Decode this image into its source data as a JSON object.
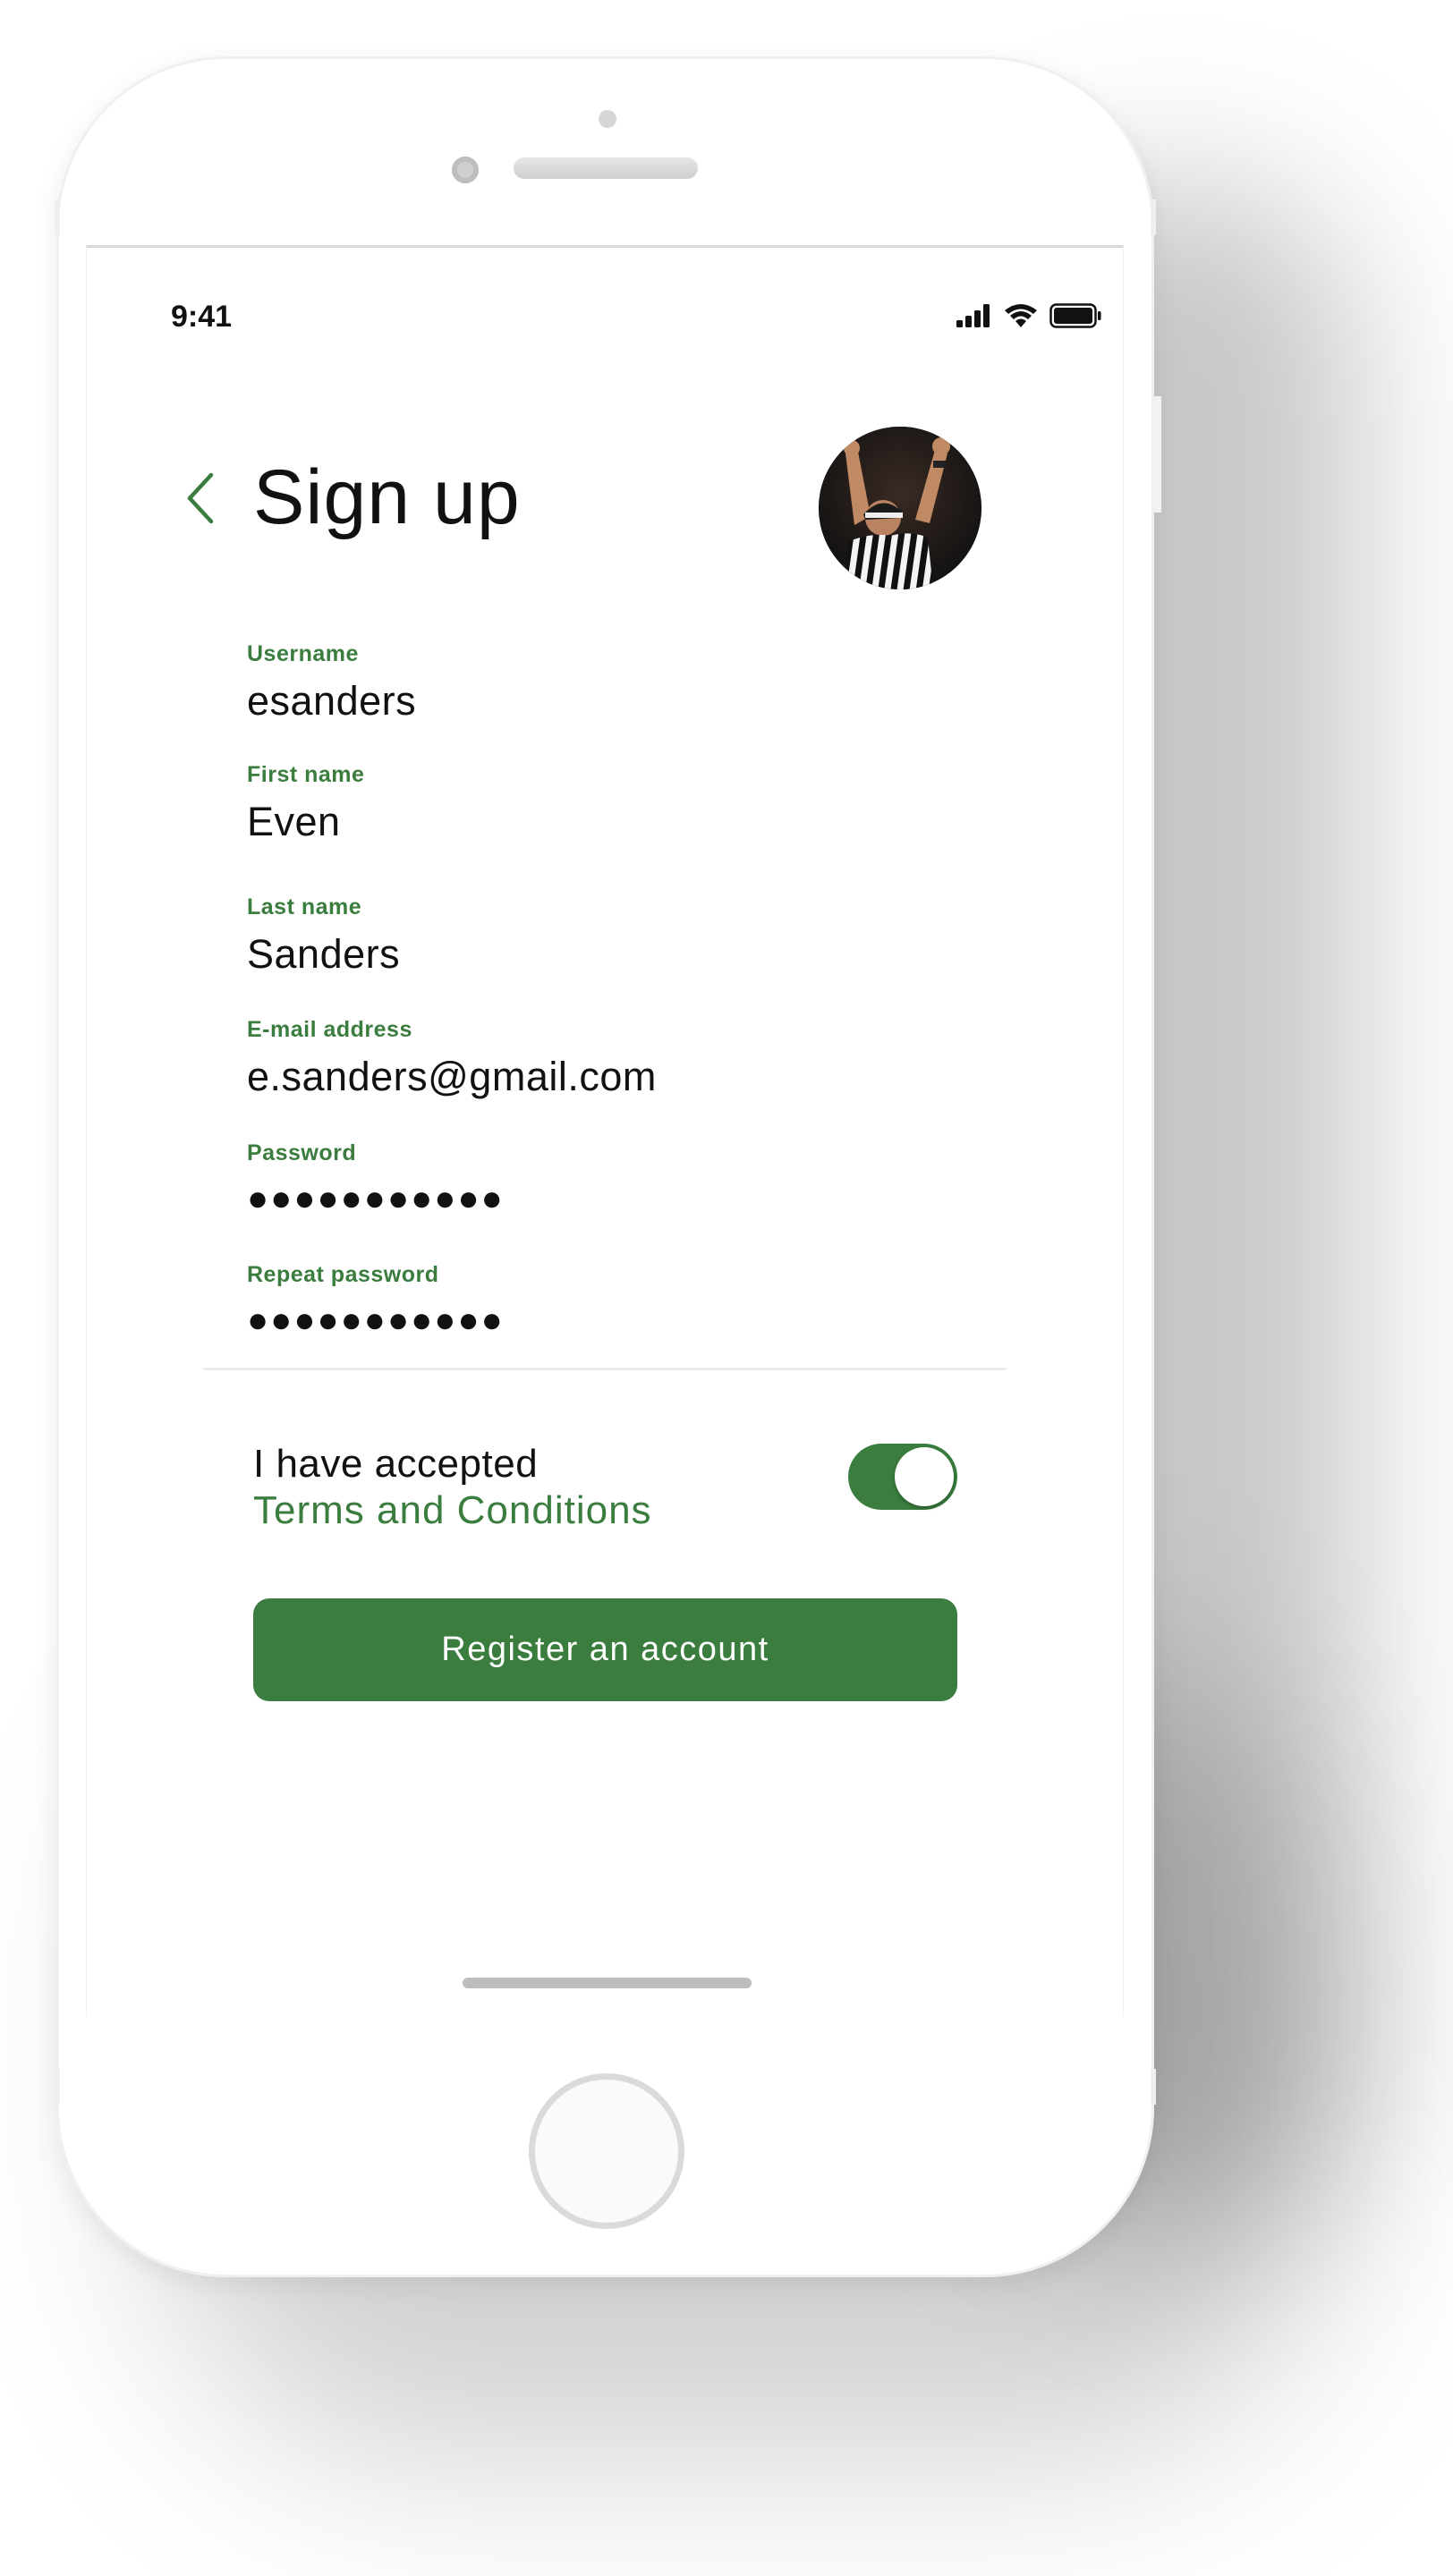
{
  "status_bar": {
    "time": "9:41",
    "icons": [
      "cellular-signal-icon",
      "wifi-icon",
      "battery-icon"
    ]
  },
  "header": {
    "back_icon": "chevron-left-icon",
    "title": "Sign up",
    "avatar": "referee-avatar"
  },
  "form": {
    "fields": [
      {
        "label": "Username",
        "value": "esanders"
      },
      {
        "label": "First name",
        "value": "Even"
      },
      {
        "label": "Last name",
        "value": "Sanders"
      },
      {
        "label": "E-mail address",
        "value": "e.sanders@gmail.com"
      },
      {
        "label": "Password",
        "value": "●●●●●●●●●●●"
      },
      {
        "label": "Repeat password",
        "value": "●●●●●●●●●●●"
      }
    ]
  },
  "terms": {
    "text": "I have accepted",
    "link": "Terms and Conditions",
    "accepted": true
  },
  "register": {
    "label": "Register an account"
  },
  "colors": {
    "accent": "#3a7d3e",
    "text": "#111111",
    "divider": "#ececec"
  }
}
